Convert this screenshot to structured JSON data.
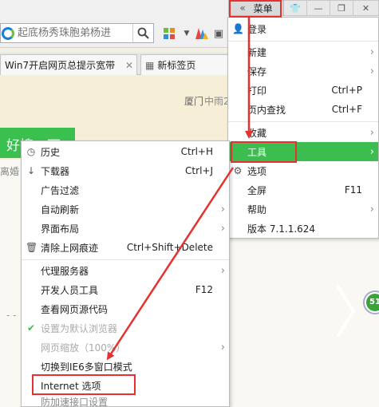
{
  "search": {
    "placeholder": "起底杨秀珠胞弟杨进"
  },
  "tabs": [
    {
      "label": "Win7开启网页总提示宽带"
    },
    {
      "label": "新标签页"
    }
  ],
  "page": {
    "city": "厦门",
    "city2": "中雨2",
    "green_button": "好搜一下",
    "left_text": "离婚",
    "dashes": "- -",
    "badge": "51"
  },
  "window_controls": {
    "menu_label": "菜单"
  },
  "main_menu": {
    "login": "登录",
    "new": "新建",
    "save": "保存",
    "print": "打印",
    "print_shortcut": "Ctrl+P",
    "find": "页内查找",
    "find_shortcut": "Ctrl+F",
    "favorites": "收藏",
    "tools": "工具",
    "options": "选项",
    "fullscreen": "全屏",
    "fullscreen_shortcut": "F11",
    "help": "帮助",
    "version": "版本 7.1.1.624"
  },
  "tools_menu": {
    "history": "历史",
    "history_shortcut": "Ctrl+H",
    "downloads": "下载器",
    "downloads_shortcut": "Ctrl+J",
    "adfilter": "广告过滤",
    "autorefresh": "自动刷新",
    "layout": "界面布局",
    "clear": "清除上网痕迹",
    "clear_shortcut": "Ctrl+Shift+Delete",
    "proxy": "代理服务器",
    "devtools": "开发人员工具",
    "devtools_shortcut": "F12",
    "viewsource": "查看网页源代码",
    "setdefault": "设置为默认浏览器",
    "zoom": "网页缩放（100%）",
    "ie6": "切换到IE6多窗口模式",
    "internet_options": "Internet 选项",
    "last": "防加速接口设置"
  },
  "colors": {
    "accent_green": "#3dbd4f",
    "annotation_red": "#e5312f"
  }
}
